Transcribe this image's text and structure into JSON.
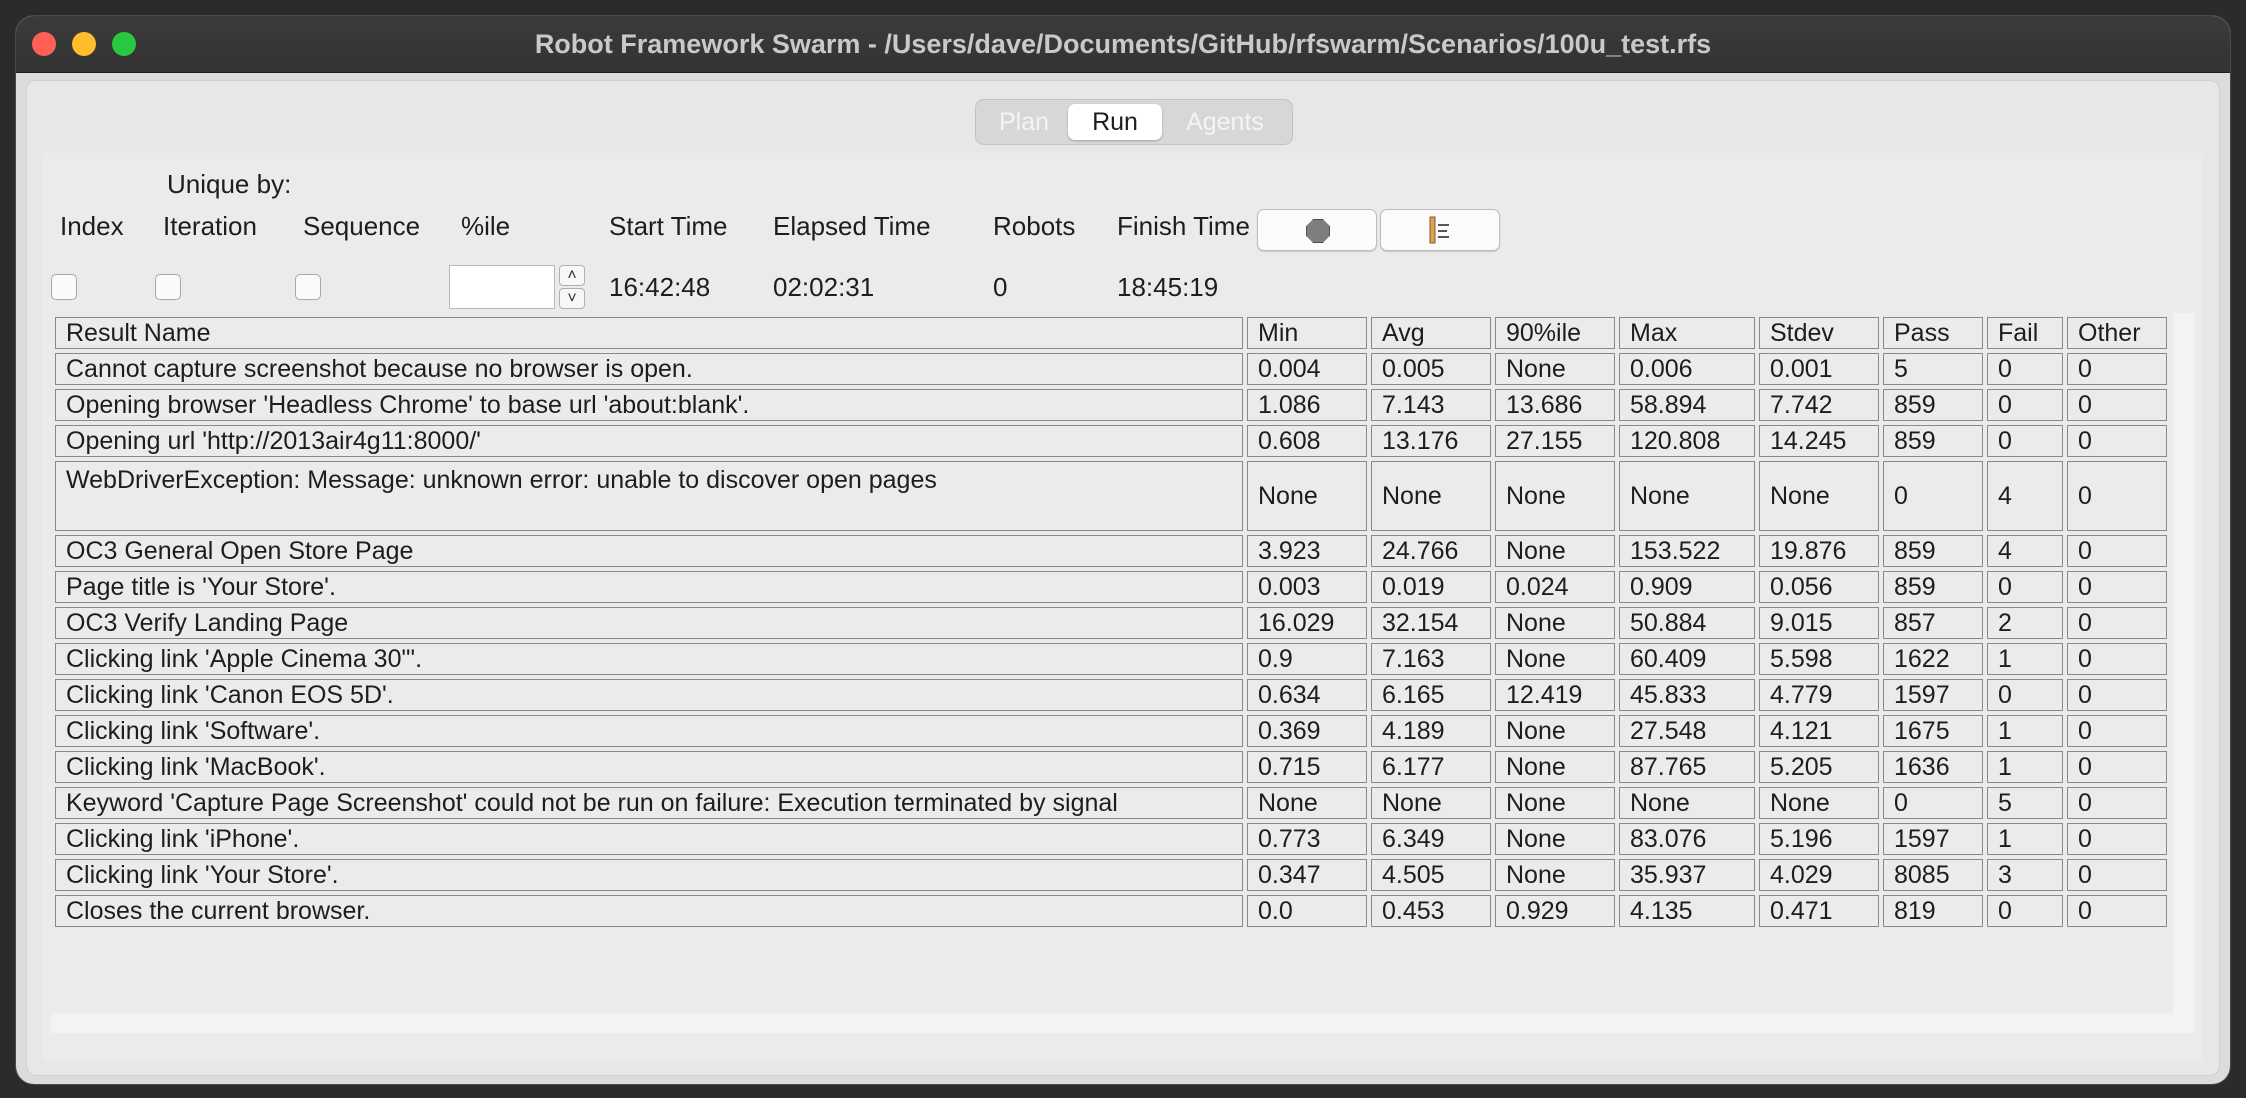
{
  "window": {
    "title": "Robot Framework Swarm - /Users/dave/Documents/GitHub/rfswarm/Scenarios/100u_test.rfs"
  },
  "tabs": [
    {
      "label": "Plan",
      "selected": false
    },
    {
      "label": "Run",
      "selected": true
    },
    {
      "label": "Agents",
      "selected": false
    }
  ],
  "controls": {
    "unique_by_label": "Unique by:",
    "index_label": "Index",
    "iteration_label": "Iteration",
    "sequence_label": "Sequence",
    "percentile_label": "%ile",
    "percentile_value": "",
    "start_time_label": "Start Time",
    "start_time": "16:42:48",
    "elapsed_time_label": "Elapsed Time",
    "elapsed_time": "02:02:31",
    "robots_label": "Robots",
    "robots": "0",
    "finish_time_label": "Finish Time",
    "finish_time": "18:45:19",
    "stop_icon": "stop-icon",
    "report_icon": "report-icon"
  },
  "table": {
    "columns": [
      "Result Name",
      "Min",
      "Avg",
      "90%ile",
      "Max",
      "Stdev",
      "Pass",
      "Fail",
      "Other"
    ],
    "rows": [
      [
        "Cannot capture screenshot because no browser is open.",
        "0.004",
        "0.005",
        "None",
        "0.006",
        "0.001",
        "5",
        "0",
        "0"
      ],
      [
        "Opening browser 'Headless Chrome' to base url 'about:blank'.",
        "1.086",
        "7.143",
        "13.686",
        "58.894",
        "7.742",
        "859",
        "0",
        "0"
      ],
      [
        "Opening url 'http://2013air4g11:8000/'",
        "0.608",
        "13.176",
        "27.155",
        "120.808",
        "14.245",
        "859",
        "0",
        "0"
      ],
      [
        "WebDriverException: Message: unknown error: unable to discover open pages",
        "None",
        "None",
        "None",
        "None",
        "None",
        "0",
        "4",
        "0"
      ],
      [
        "OC3 General Open Store Page",
        "3.923",
        "24.766",
        "None",
        "153.522",
        "19.876",
        "859",
        "4",
        "0"
      ],
      [
        "Page title is 'Your Store'.",
        "0.003",
        "0.019",
        "0.024",
        "0.909",
        "0.056",
        "859",
        "0",
        "0"
      ],
      [
        "OC3 Verify Landing Page",
        "16.029",
        "32.154",
        "None",
        "50.884",
        "9.015",
        "857",
        "2",
        "0"
      ],
      [
        "Clicking link 'Apple Cinema 30\"'.",
        "0.9",
        "7.163",
        "None",
        "60.409",
        "5.598",
        "1622",
        "1",
        "0"
      ],
      [
        "Clicking link 'Canon EOS 5D'.",
        "0.634",
        "6.165",
        "12.419",
        "45.833",
        "4.779",
        "1597",
        "0",
        "0"
      ],
      [
        "Clicking link 'Software'.",
        "0.369",
        "4.189",
        "None",
        "27.548",
        "4.121",
        "1675",
        "1",
        "0"
      ],
      [
        "Clicking link 'MacBook'.",
        "0.715",
        "6.177",
        "None",
        "87.765",
        "5.205",
        "1636",
        "1",
        "0"
      ],
      [
        "Keyword 'Capture Page Screenshot' could not be run on failure: Execution terminated by signal",
        "None",
        "None",
        "None",
        "None",
        "None",
        "0",
        "5",
        "0"
      ],
      [
        "Clicking link 'iPhone'.",
        "0.773",
        "6.349",
        "None",
        "83.076",
        "5.196",
        "1597",
        "1",
        "0"
      ],
      [
        "Clicking link 'Your Store'.",
        "0.347",
        "4.505",
        "None",
        "35.937",
        "4.029",
        "8085",
        "3",
        "0"
      ],
      [
        "Closes the current browser.",
        "0.0",
        "0.453",
        "0.929",
        "4.135",
        "0.471",
        "819",
        "0",
        "0"
      ]
    ]
  }
}
